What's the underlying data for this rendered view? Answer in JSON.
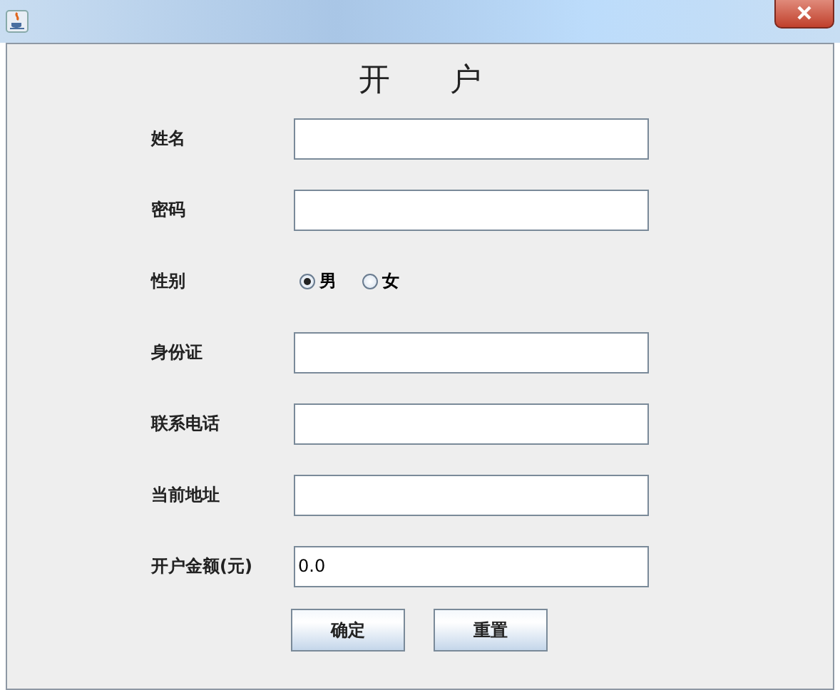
{
  "window": {
    "title": "开      户"
  },
  "fields": [
    {
      "kind": "text",
      "label": "姓名"
    },
    {
      "kind": "text",
      "label": "密码"
    },
    {
      "kind": "radio",
      "label": "性别",
      "options": [
        {
          "label": "男",
          "selected": true
        },
        {
          "label": "女",
          "selected": false
        }
      ]
    },
    {
      "kind": "text",
      "label": "身份证"
    },
    {
      "kind": "text",
      "label": "联系电话"
    },
    {
      "kind": "text",
      "label": "当前地址"
    },
    {
      "kind": "text",
      "label": "开户金额(元)",
      "value": "0.0"
    }
  ],
  "buttons": [
    "确定",
    "重置"
  ]
}
